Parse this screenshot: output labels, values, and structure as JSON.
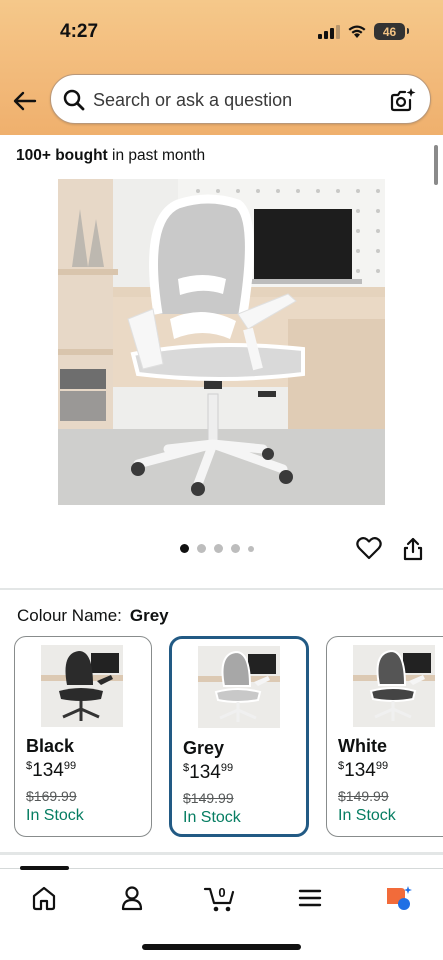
{
  "status_bar": {
    "time": "4:27",
    "battery": "46"
  },
  "search": {
    "placeholder": "Search or ask a question"
  },
  "social_proof": {
    "bold": "100+ bought",
    "rest": "in past month"
  },
  "gallery": {
    "image_count": 5,
    "active_index": 0
  },
  "colour": {
    "label": "Colour Name:",
    "selected": "Grey"
  },
  "variants": [
    {
      "name": "Black",
      "currency": "$",
      "price_whole": "134",
      "price_cents": "99",
      "was": "$169.99",
      "stock": "In Stock",
      "chair_color": "#2b2b2b"
    },
    {
      "name": "Grey",
      "currency": "$",
      "price_whole": "134",
      "price_cents": "99",
      "was": "$149.99",
      "stock": "In Stock",
      "chair_color": "#a7a7a7"
    },
    {
      "name": "White",
      "currency": "$",
      "price_whole": "134",
      "price_cents": "99",
      "was": "$149.99",
      "stock": "In Stock",
      "chair_color": "#555555"
    }
  ],
  "bottom_nav": {
    "items": [
      "home-icon",
      "account-icon",
      "cart-icon",
      "menu-icon",
      "rufus-icon"
    ],
    "cart_count": "0"
  },
  "colors": {
    "header": "#f2b979",
    "selected_border": "#225a84",
    "in_stock": "#067d62",
    "rufus_orange": "#f26b3a",
    "rufus_blue": "#1f6fe5"
  }
}
